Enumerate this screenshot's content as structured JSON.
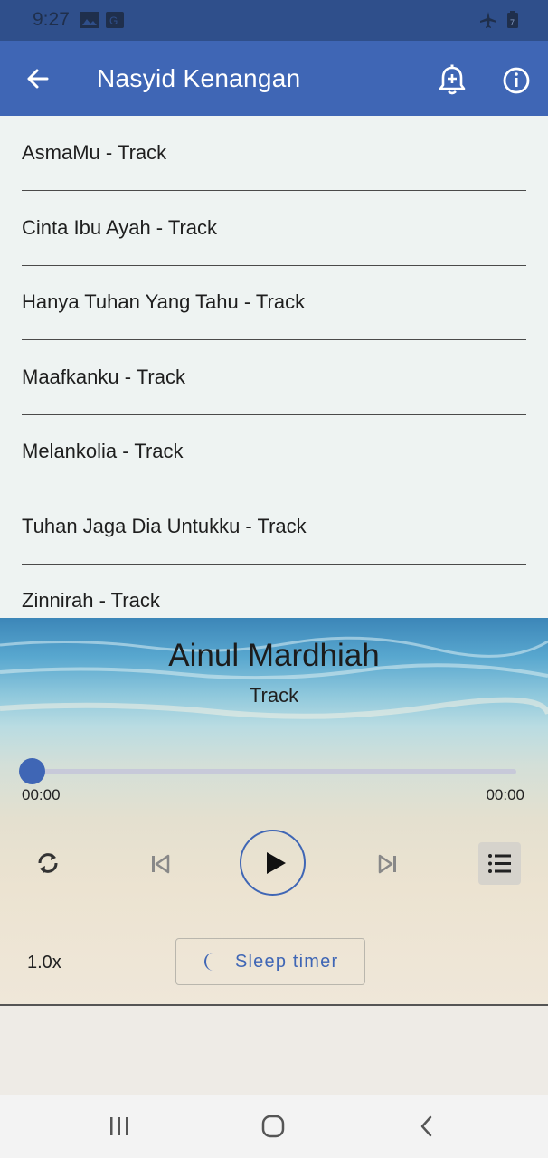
{
  "status": {
    "time": "9:27"
  },
  "appbar": {
    "title": "Nasyid Kenangan"
  },
  "tracks": [
    "AsmaMu - Track",
    "Cinta Ibu Ayah - Track",
    "Hanya Tuhan Yang Tahu - Track",
    "Maafkanku - Track",
    "Melankolia - Track",
    "Tuhan Jaga Dia Untukku - Track",
    "Zinnirah - Track"
  ],
  "player": {
    "title": "Ainul Mardhiah",
    "artist": "Track",
    "elapsed": "00:00",
    "duration": "00:00",
    "progress": 0,
    "speed": "1.0x",
    "sleep_label": "Sleep timer"
  },
  "colors": {
    "accent": "#3f66b5",
    "statusbar": "#2f4f8b",
    "list_bg": "#eef3f2"
  },
  "icons": {
    "back": "arrow-left-icon",
    "bell": "bell-plus-icon",
    "info": "info-icon",
    "repeat": "repeat-icon",
    "previous": "skip-previous-icon",
    "play": "play-icon",
    "next": "skip-next-icon",
    "queue": "queue-list-icon",
    "moon": "moon-icon"
  }
}
